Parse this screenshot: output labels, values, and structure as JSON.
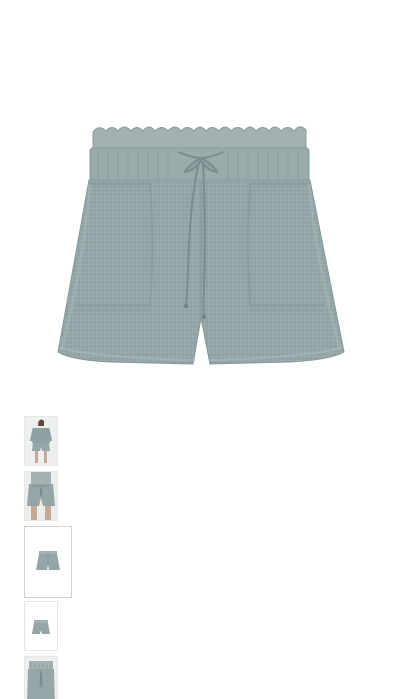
{
  "product": {
    "main_image": {
      "icon": "gray-linen-paperbag-shorts-image",
      "colors": {
        "fabric": "#94a6a7",
        "fabric_shadow": "#7f9293",
        "fabric_highlight": "#a9b8b9",
        "drawcord": "#7a8c8d",
        "background": "#ffffff"
      }
    },
    "thumbnails": [
      {
        "icon": "model-full-outfit-thumbnail",
        "selected": false
      },
      {
        "icon": "model-shorts-closeup-thumbnail",
        "selected": false
      },
      {
        "icon": "shorts-flatlay-thumbnail",
        "selected": true
      },
      {
        "icon": "shorts-back-flatlay-thumbnail",
        "selected": false
      },
      {
        "icon": "shorts-detail-thumbnail",
        "selected": false
      }
    ]
  }
}
